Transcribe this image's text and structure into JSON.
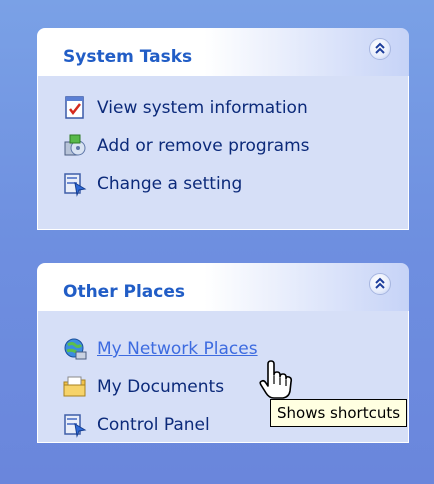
{
  "system_tasks": {
    "title": "System Tasks",
    "items": [
      {
        "label": "View system information",
        "icon": "system-information-icon"
      },
      {
        "label": "Add or remove programs",
        "icon": "add-remove-programs-icon"
      },
      {
        "label": "Change a setting",
        "icon": "control-panel-icon"
      }
    ]
  },
  "other_places": {
    "title": "Other Places",
    "items": [
      {
        "label": "My Network Places",
        "icon": "network-places-icon",
        "state": "hover"
      },
      {
        "label": "My Documents",
        "icon": "my-documents-icon"
      },
      {
        "label": "Control Panel",
        "icon": "control-panel-icon"
      }
    ]
  },
  "tooltip": {
    "text": "Shows shortcuts"
  },
  "colors": {
    "header_title": "#215dc6",
    "panel_body": "#d6dff7",
    "link_text": "#0c2a7a",
    "link_hover": "#3d6be0",
    "background": "#6e8fe0",
    "tooltip_bg": "#ffffe1"
  }
}
